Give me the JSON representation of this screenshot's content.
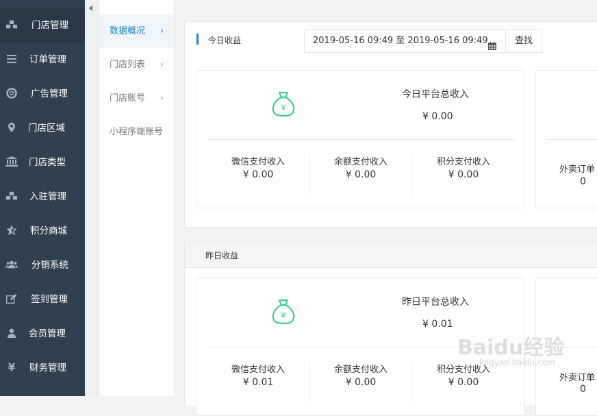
{
  "sidebar": {
    "items": [
      {
        "label": "门店管理",
        "icon": "cubes-icon",
        "active": true
      },
      {
        "label": "订单管理",
        "icon": "list-icon"
      },
      {
        "label": "广告管理",
        "icon": "lifebuoy-icon"
      },
      {
        "label": "门店区域",
        "icon": "map-marker-icon"
      },
      {
        "label": "门店类型",
        "icon": "bank-icon"
      },
      {
        "label": "入驻管理",
        "icon": "cubes-icon"
      },
      {
        "label": "积分商城",
        "icon": "star-half-icon"
      },
      {
        "label": "分销系统",
        "icon": "users-icon"
      },
      {
        "label": "签到管理",
        "icon": "edit-icon"
      },
      {
        "label": "会员管理",
        "icon": "user-icon"
      },
      {
        "label": "财务管理",
        "icon": "yen-icon"
      }
    ]
  },
  "submenu": {
    "items": [
      {
        "label": "数据概况",
        "arrow": "›",
        "active": true
      },
      {
        "label": "门店列表",
        "arrow": "›"
      },
      {
        "label": "门店账号",
        "arrow": "›"
      },
      {
        "label": "小程序端账号",
        "arrow": ""
      }
    ]
  },
  "today": {
    "title": "今日收益",
    "date_range": "2019-05-16 09:49 至 2019-05-16 09:49",
    "search_label": "查找",
    "total_label": "今日平台总收入",
    "total_value": "¥ 0.00",
    "breakdown": [
      {
        "label": "微信支付收入",
        "value": "¥ 0.00"
      },
      {
        "label": "余额支付收入",
        "value": "¥ 0.00"
      },
      {
        "label": "积分支付收入",
        "value": "¥ 0.00"
      }
    ],
    "side_label": "外卖订单",
    "side_value": "0"
  },
  "yesterday": {
    "title": "昨日收益",
    "total_label": "昨日平台总收入",
    "total_value": "¥ 0.01",
    "breakdown": [
      {
        "label": "微信支付收入",
        "value": "¥ 0.01"
      },
      {
        "label": "余额支付收入",
        "value": "¥ 0.00"
      },
      {
        "label": "积分支付收入",
        "value": "¥ 0.00"
      }
    ],
    "side_label": "外卖订单",
    "side_value": "0"
  },
  "colors": {
    "sidebar": "#2f4050",
    "accent": "#1c84c6",
    "money_icon": "#3fcf8e"
  },
  "watermark": {
    "brand": "Baidu经验",
    "url": "jingyan.baidu.com"
  }
}
